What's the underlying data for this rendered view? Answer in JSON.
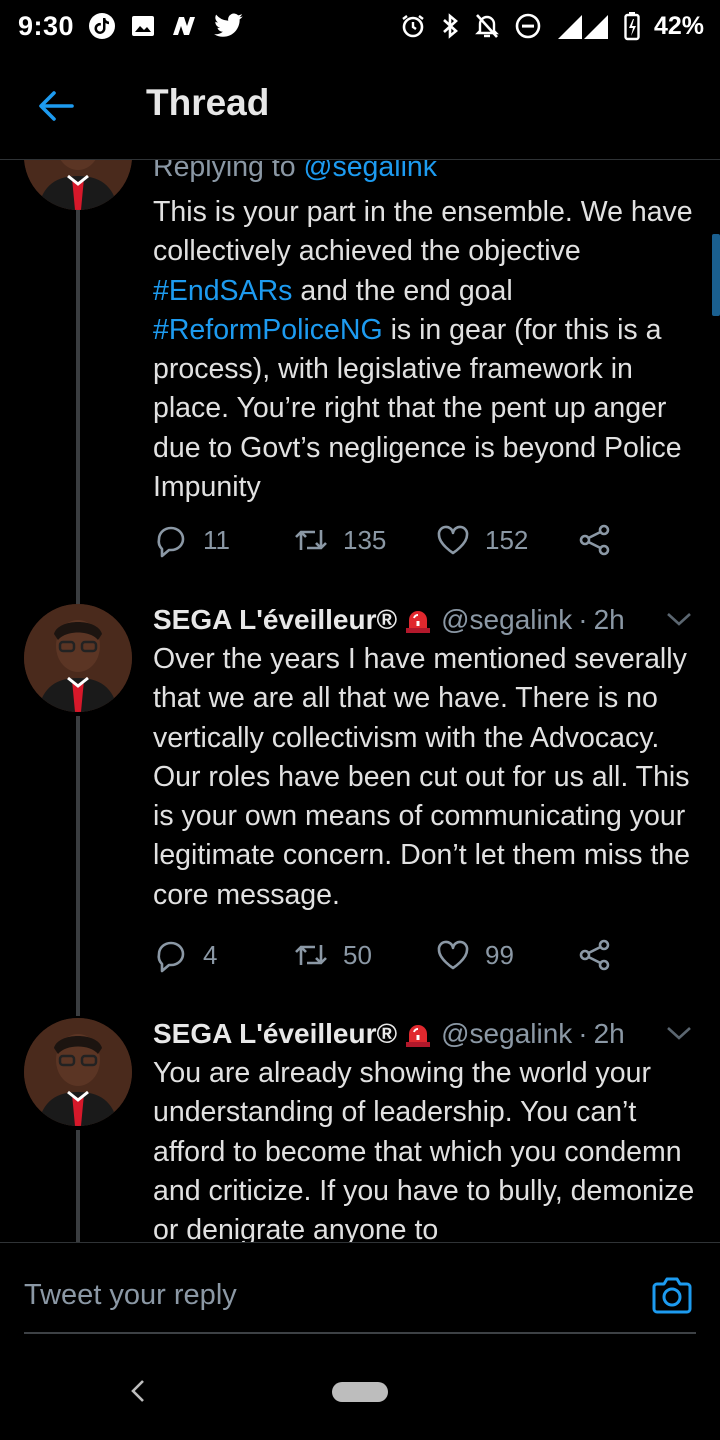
{
  "status_bar": {
    "time": "9:30",
    "left_icons": [
      "tiktok-icon",
      "image-icon",
      "n-app-icon",
      "twitter-icon"
    ],
    "right_icons": [
      "alarm-icon",
      "bluetooth-icon",
      "mute-icon",
      "dnd-icon",
      "signal-icon",
      "network-3g-icon",
      "battery-charging-icon"
    ],
    "network": "3G",
    "battery": "42%"
  },
  "header": {
    "title": "Thread",
    "back_icon": "arrow-left-icon"
  },
  "colors": {
    "accent": "#1d9bf0",
    "background": "#000000",
    "muted": "#8b98a5",
    "siren": "#e0282e"
  },
  "tweets": [
    {
      "replying_prefix": "Replying to",
      "replying_to": "@segalink",
      "text_parts": [
        "This is your part in the ensemble. We have collectively achieved the objective ",
        "#EndSARs",
        " and the end goal ",
        "#ReformPoliceNG",
        " is in gear (for this is a process), with legislative framework in place. You’re right that the pent up anger due to Govt’s negligence is beyond Police Impunity"
      ],
      "replies": "11",
      "retweets": "135",
      "likes": "152"
    },
    {
      "name": "SEGA L'éveilleur®",
      "handle": "@segalink",
      "separator": "·",
      "time": "2h",
      "text": "Over the years I have mentioned severally that we are all that we have. There is no vertically collectivism with the Advocacy. Our roles have been cut out for us all. This is your own means of communicating your legitimate concern. Don’t let them miss the core message.",
      "replies": "4",
      "retweets": "50",
      "likes": "99"
    },
    {
      "name": "SEGA L'éveilleur®",
      "handle": "@segalink",
      "separator": "·",
      "time": "2h",
      "text": "You are already showing the world your understanding of leadership. You can’t afford to become that which you condemn and criticize. If you have to bully, demonize or denigrate anyone to"
    }
  ],
  "reply_bar": {
    "placeholder": "Tweet your reply",
    "camera_icon": "camera-icon"
  },
  "nav_bar": {
    "back_icon": "nav-back-icon",
    "home_icon": "home-pill-icon"
  }
}
